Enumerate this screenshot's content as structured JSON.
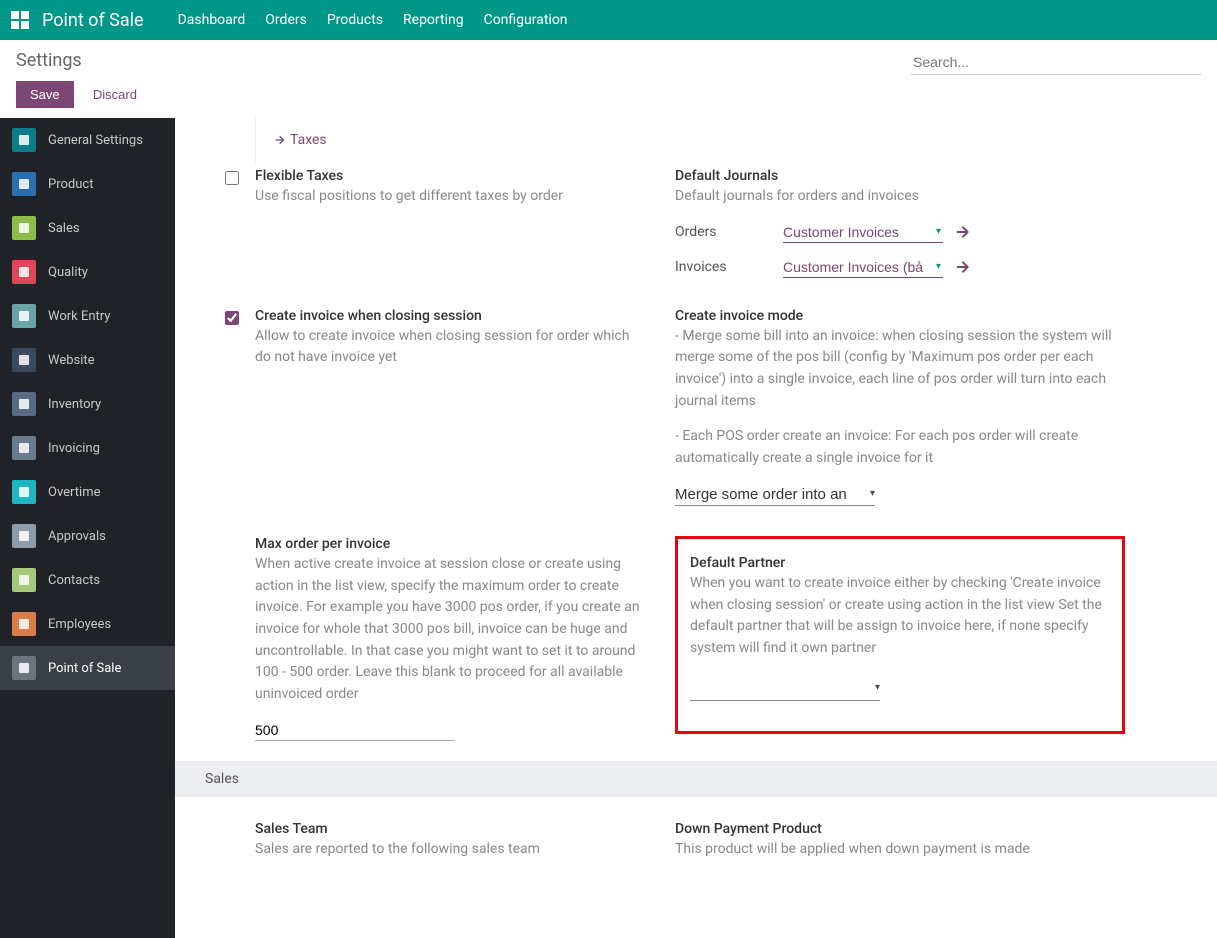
{
  "topbar": {
    "app_title": "Point of Sale",
    "nav": [
      "Dashboard",
      "Orders",
      "Products",
      "Reporting",
      "Configuration"
    ]
  },
  "header": {
    "breadcrumb": "Settings",
    "search_placeholder": "Search..."
  },
  "actions": {
    "save": "Save",
    "discard": "Discard"
  },
  "sidebar": {
    "items": [
      {
        "label": "General Settings",
        "bg": "#0d7d8c"
      },
      {
        "label": "Product",
        "bg": "#2b6fb3"
      },
      {
        "label": "Sales",
        "bg": "#8bbd4a"
      },
      {
        "label": "Quality",
        "bg": "#e0455e"
      },
      {
        "label": "Work Entry",
        "bg": "#6aa5a5"
      },
      {
        "label": "Website",
        "bg": "#3b4a5b"
      },
      {
        "label": "Inventory",
        "bg": "#5a6b82"
      },
      {
        "label": "Invoicing",
        "bg": "#6a7b8e"
      },
      {
        "label": "Overtime",
        "bg": "#1fb6c1"
      },
      {
        "label": "Approvals",
        "bg": "#8e9ba8"
      },
      {
        "label": "Contacts",
        "bg": "#a7c77d"
      },
      {
        "label": "Employees",
        "bg": "#d97d4a"
      },
      {
        "label": "Point of Sale",
        "bg": "#6a7580",
        "active": true
      }
    ]
  },
  "content": {
    "taxes_link": "Taxes",
    "flex_taxes": {
      "title": "Flexible Taxes",
      "desc": "Use fiscal positions to get different taxes by order"
    },
    "default_journals": {
      "title": "Default Journals",
      "desc": "Default journals for orders and invoices",
      "orders_label": "Orders",
      "orders_value": "Customer Invoices",
      "invoices_label": "Invoices",
      "invoices_value": "Customer Invoices (bả"
    },
    "create_invoice": {
      "title": "Create invoice when closing session",
      "desc": "Allow to create invoice when closing session for order which do not have invoice yet"
    },
    "invoice_mode": {
      "title": "Create invoice mode",
      "desc1": "- Merge some bill into an invoice: when closing session the system will merge some of the pos bill (config by 'Maximum pos order per each invoice') into a single invoice, each line of pos order will turn into each journal items",
      "desc2": "- Each POS order create an invoice: For each pos order will create automatically create a single invoice for it",
      "select_value": "Merge some order into an"
    },
    "max_order": {
      "title": "Max order per invoice",
      "desc": "When active create invoice at session close or create using action in the list view, specify the maximum order to create invoice. For example you have 3000 pos order, if you create an invoice for whole that 3000 pos bill, invoice can be huge and uncontrollable. In that case you might want to set it to around 100 - 500 order. Leave this blank to proceed for all available uninvoiced order",
      "value": "500"
    },
    "default_partner": {
      "title": "Default Partner",
      "desc": "When you want to create invoice either by checking 'Create invoice when closing session' or create using action in the list view Set the default partner that will be assign to invoice here, if none specify system will find it own partner"
    },
    "sales_section": "Sales",
    "sales_team": {
      "title": "Sales Team",
      "desc": "Sales are reported to the following sales team"
    },
    "down_payment": {
      "title": "Down Payment Product",
      "desc": "This product will be applied when down payment is made"
    }
  }
}
